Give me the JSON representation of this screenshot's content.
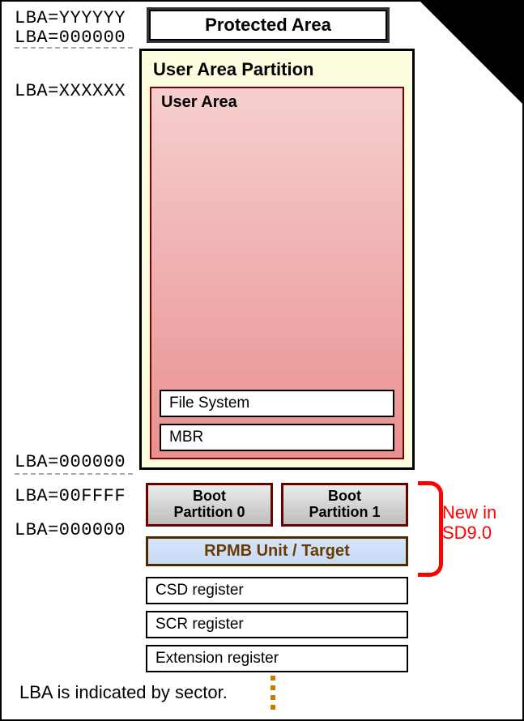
{
  "lba_labels": {
    "prot_top": "LBA=YYYYYY",
    "prot_bottom": "LBA=000000",
    "user_top": "LBA=XXXXXX",
    "user_bottom": "LBA=000000",
    "boot_top": "LBA=00FFFF",
    "boot_bottom": "LBA=000000"
  },
  "protected_area": "Protected Area",
  "user_partition": {
    "title": "User Area Partition",
    "user_area_title": "User Area",
    "fs": "File System",
    "mbr": "MBR"
  },
  "boot": {
    "p0_l1": "Boot",
    "p0_l2": "Partition 0",
    "p1_l1": "Boot",
    "p1_l2": "Partition 1"
  },
  "rpmb": "RPMB Unit / Target",
  "registers": {
    "csd": "CSD register",
    "scr": "SCR register",
    "ext": "Extension register"
  },
  "callout": {
    "l1": "New in",
    "l2": "SD9.0"
  },
  "footer": "LBA is indicated by sector."
}
